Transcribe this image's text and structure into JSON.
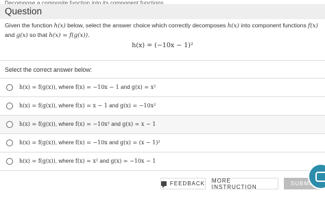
{
  "topic": "Decompose a composite function into its component functions",
  "header": {
    "title": "Question"
  },
  "prompt": {
    "p1": "Given the function ",
    "fn": "h(x)",
    "p2": " below, select the answer choice which correctly decomposes ",
    "fn2": "h(x)",
    "p3": " into component functions ",
    "f": "f(x)",
    "p4": "and ",
    "g": "g(x)",
    "p5": " so that ",
    "comp": "h(x) = f(g(x)).",
    "formula": "h(x) = (−10x − 1)²"
  },
  "select_label": "Select the correct answer below:",
  "options": [
    {
      "lead": "h(x) = f(g(x))",
      "mid": ", where ",
      "f": "f(x) = −10x − 1",
      "and": " and ",
      "g": "g(x) = x²"
    },
    {
      "lead": "h(x) = f(g(x))",
      "mid": ", where ",
      "f": "f(x) = x − 1",
      "and": " and ",
      "g": "g(x) = −10x²"
    },
    {
      "lead": "h(x) = f(g(x))",
      "mid": ", where ",
      "f": "f(x) = −10x²",
      "and": " and ",
      "g": "g(x) = x − 1"
    },
    {
      "lead": "h(x) = f(g(x))",
      "mid": ", where ",
      "f": "f(x) = −10x",
      "and": " and ",
      "g": "g(x) = (x − 1)²"
    },
    {
      "lead": "h(x) = f(g(x))",
      "mid": ", where ",
      "f": "f(x) = x²",
      "and": " and ",
      "g": "g(x) = −10x − 1"
    }
  ],
  "buttons": {
    "feedback": "FEEDBACK",
    "instruction": "MORE INSTRUCTION",
    "submit": "SUBMIT"
  },
  "icons": {
    "feedback": "comment-icon",
    "chat": "chat-bubble-icon"
  },
  "colors": {
    "chat": "#2c8dab",
    "submit_disabled": "#bdbdbd"
  }
}
